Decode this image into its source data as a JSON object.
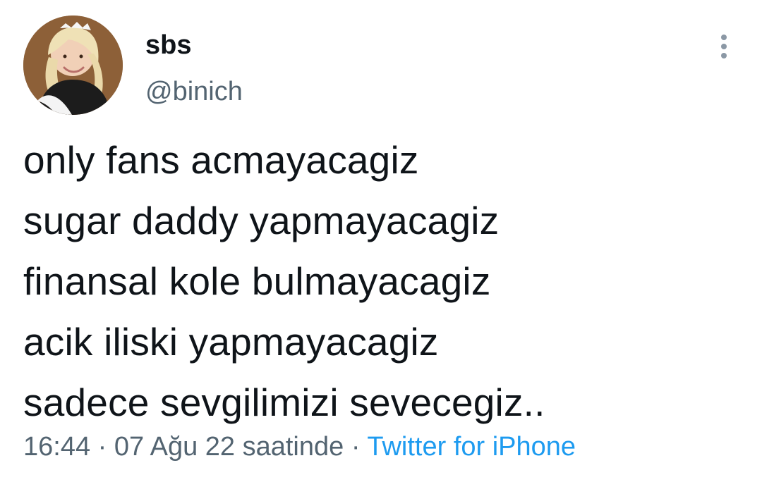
{
  "tweet": {
    "display_name": "sbs",
    "handle": "@binich",
    "lines": [
      "only fans acmayacagiz",
      "sugar daddy yapmayacagiz",
      "finansal kole bulmayacagiz",
      "acik iliski yapmayacagiz",
      "sadece sevgilimizi sevecegiz.."
    ],
    "time": "16:44",
    "separator": "·",
    "date": "07 Ağu 22 saatinde",
    "source": "Twitter for iPhone"
  },
  "icons": {
    "more": "more-options-icon",
    "avatar": "profile-avatar"
  },
  "colors": {
    "text": "#0f1419",
    "secondary": "#536471",
    "link": "#1d9bf0"
  }
}
